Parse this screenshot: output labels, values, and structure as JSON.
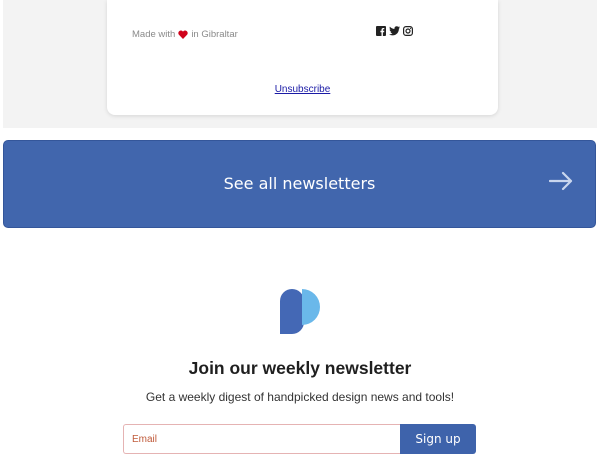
{
  "footer": {
    "made_with_prefix": "Made with",
    "made_with_suffix": "in Gibraltar",
    "heart_color": "#d0021b",
    "social_icons": [
      "facebook-icon",
      "twitter-icon",
      "instagram-icon"
    ],
    "unsubscribe_label": "Unsubscribe"
  },
  "cta": {
    "label": "See all newsletters",
    "arrow_icon": "arrow-right-icon",
    "background_color": "#4166ad"
  },
  "signup": {
    "logo_icon": "brand-logo-icon",
    "title": "Join our weekly newsletter",
    "subtitle": "Get a weekly digest of handpicked design news and tools!",
    "email_placeholder": "Email",
    "email_value": "",
    "button_label": "Sign up",
    "button_color": "#3e63ab"
  }
}
